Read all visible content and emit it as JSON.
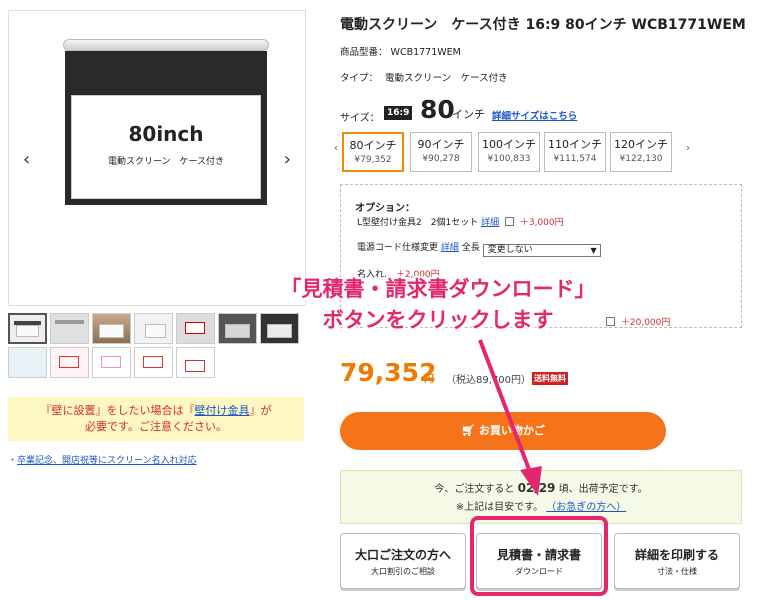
{
  "product": {
    "title": "電動スクリーン　ケース付き 16:9 80インチ WCB1771WEM",
    "sku_label": "商品型番：",
    "sku": "WCB1771WEM",
    "type_label": "タイプ：",
    "type_value": "電動スクリーン　ケース付き",
    "image_size_text": "80inch",
    "image_caption": "電動スクリーン　ケース付き"
  },
  "size": {
    "label": "サイズ：",
    "ratio": "16:9",
    "value": "80",
    "unit": "インチ",
    "detail_link": "詳細サイズはこちら",
    "options": [
      {
        "label": "80インチ",
        "price": "¥79,352",
        "selected": true
      },
      {
        "label": "90インチ",
        "price": "¥90,278",
        "selected": false
      },
      {
        "label": "100インチ",
        "price": "¥100,833",
        "selected": false
      },
      {
        "label": "110インチ",
        "price": "¥111,574",
        "selected": false
      },
      {
        "label": "120インチ",
        "price": "¥122,130",
        "selected": false
      }
    ]
  },
  "options": {
    "title": "オプション：",
    "line1_text": "L型壁付け金具2　2個1セット",
    "line1_link": "詳細",
    "line1_price": "＋3,000円",
    "line2_text": "電源コード仕様変更",
    "line2_link": "詳細",
    "line2_label": "全長",
    "line2_select": "変更しない",
    "line3_text": "名入れ…",
    "line3_price": "＋2,000円",
    "line4_price": "＋20,000円"
  },
  "price": {
    "value": "79,352",
    "unit": "円",
    "tax": "（税込89,700円）",
    "free_shipping": "送料無料"
  },
  "cart_button": "お買い物かご",
  "shipping": {
    "line1_pre": "今、ご注文すると",
    "line1_date": "02/29",
    "line1_post": "頃、出荷予定です。",
    "line2_pre": "※上記は目安です。",
    "line2_link": "（お急ぎの方へ）"
  },
  "buttons": {
    "bulk_main": "大口ご注文の方へ",
    "bulk_sub": "大口割引のご相談",
    "quote_main": "見積書・請求書",
    "quote_sub": "ダウンロード",
    "print_main": "詳細を印刷する",
    "print_sub": "寸法・仕様"
  },
  "notice": {
    "line1_pre": "『壁に設置』をしたい場合は『",
    "line1_link": "壁付け金具",
    "line1_post": "』が",
    "line2": "必要です。ご注意ください。"
  },
  "note_link": "卒業記念、開店祝等にスクリーン名入れ対応",
  "annotation": {
    "line1": "「見積書・請求書ダウンロード」",
    "line2": "ボタンをクリックします"
  },
  "colors": {
    "accent_orange": "#f5741a",
    "highlight_pink": "#e5266e",
    "link_blue": "#1a55c9"
  }
}
